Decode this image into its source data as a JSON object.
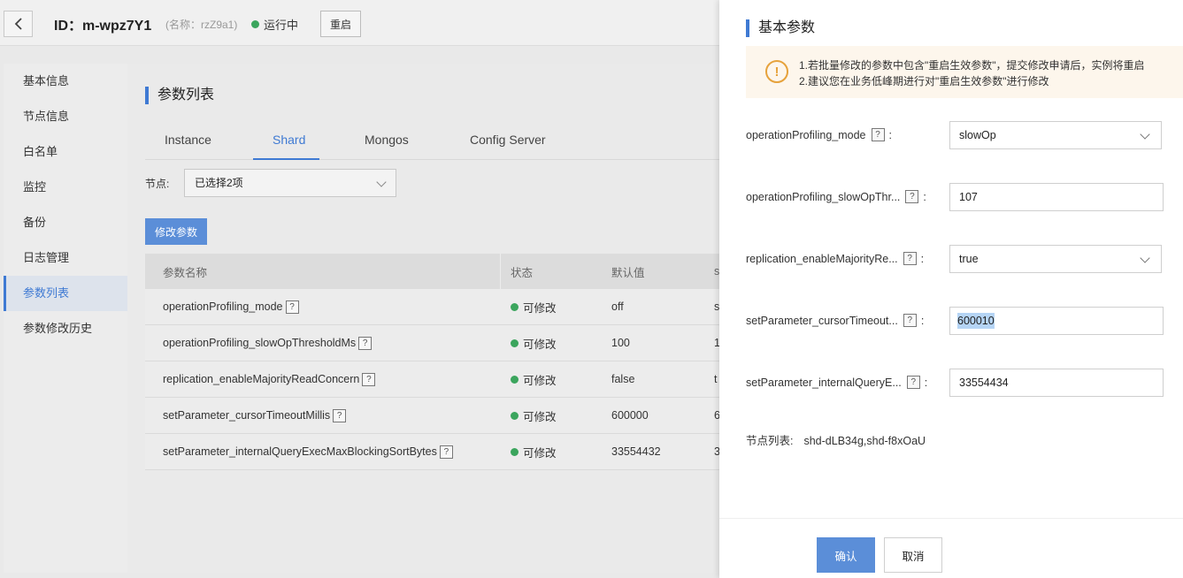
{
  "header": {
    "id_text": "ID：m-wpz7Y1",
    "name_text": "(名称：rzZ9a1)",
    "status_text": "运行中",
    "restart_label": "重启"
  },
  "sidebar": {
    "items": [
      {
        "label": "基本信息"
      },
      {
        "label": "节点信息"
      },
      {
        "label": "白名单"
      },
      {
        "label": "监控"
      },
      {
        "label": "备份"
      },
      {
        "label": "日志管理"
      },
      {
        "label": "参数列表"
      },
      {
        "label": "参数修改历史"
      }
    ],
    "active": "参数列表"
  },
  "main": {
    "title": "参数列表",
    "tabs": [
      "Instance",
      "Shard",
      "Mongos",
      "Config Server"
    ],
    "active_tab": "Shard",
    "node_label": "节点:",
    "node_select": "已选择2项",
    "modify_label": "修改参数",
    "table": {
      "headers": [
        "参数名称",
        "状态",
        "默认值",
        "s"
      ],
      "rows": [
        {
          "name": "operationProfiling_mode",
          "status": "可修改",
          "default": "off",
          "cur": "s"
        },
        {
          "name": "operationProfiling_slowOpThresholdMs",
          "status": "可修改",
          "default": "100",
          "cur": "1"
        },
        {
          "name": "replication_enableMajorityReadConcern",
          "status": "可修改",
          "default": "false",
          "cur": "t"
        },
        {
          "name": "setParameter_cursorTimeoutMillis",
          "status": "可修改",
          "default": "600000",
          "cur": "6"
        },
        {
          "name": "setParameter_internalQueryExecMaxBlockingSortBytes",
          "status": "可修改",
          "default": "33554432",
          "cur": "3"
        }
      ]
    }
  },
  "drawer": {
    "title": "基本参数",
    "alert": {
      "line1": "1.若批量修改的参数中包含\"重启生效参数\"，提交修改申请后，实例将重启",
      "line2": "2.建议您在业务低峰期进行对\"重启生效参数\"进行修改"
    },
    "fields": [
      {
        "label": "operationProfiling_mode",
        "value": "slowOp",
        "type": "select"
      },
      {
        "label": "operationProfiling_slowOpThr...",
        "value": "107",
        "type": "input"
      },
      {
        "label": "replication_enableMajorityRe...",
        "value": "true",
        "type": "select"
      },
      {
        "label": "setParameter_cursorTimeout...",
        "value": "600010",
        "type": "input"
      },
      {
        "label": "setParameter_internalQueryE...",
        "value": "33554434",
        "type": "input"
      }
    ],
    "colon": ":",
    "help_glyph": "?",
    "nodes_label": "节点列表:",
    "nodes_value": "shd-dLB34g,shd-f8xOaU",
    "confirm_label": "确认",
    "cancel_label": "取消"
  },
  "colors": {
    "accent": "#3f7ad3",
    "primary_button": "#5b8ed8",
    "running": "#3ba55d",
    "warning": "#e6a23c"
  }
}
